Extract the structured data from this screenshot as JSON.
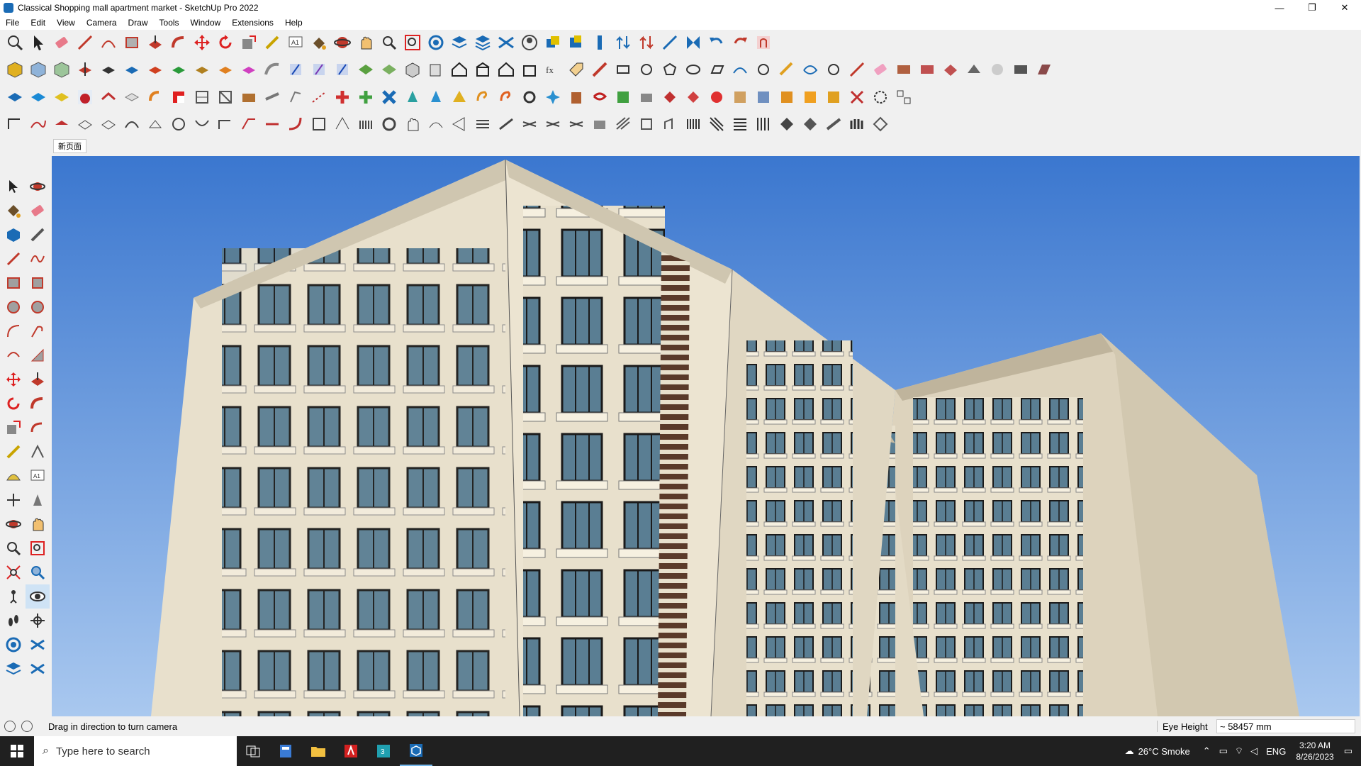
{
  "window": {
    "title": "Classical Shopping mall apartment market - SketchUp Pro 2022",
    "controls": {
      "minimize": "—",
      "restore": "❐",
      "close": "✕"
    }
  },
  "menu": [
    "File",
    "Edit",
    "View",
    "Camera",
    "Draw",
    "Tools",
    "Window",
    "Extensions",
    "Help"
  ],
  "scene_tab": "新页面",
  "status": {
    "hint": "Drag in direction to turn camera",
    "measure_label": "Eye Height",
    "measure_value": "~ 58457 mm"
  },
  "taskbar": {
    "search_placeholder": "Type here to search",
    "weather": "26°C  Smoke",
    "language": "ENG",
    "time": "3:20 AM",
    "date": "8/26/2023"
  },
  "colors": {
    "sky_top": "#3b77cf",
    "sky_bottom": "#a9c8ef",
    "facade": "#e8e0cc",
    "facade_shade": "#cfc6b0",
    "window_glass": "#5a7e93",
    "accent_brick": "#5a3a2a"
  },
  "icons": {
    "toolbar_row1": [
      "zoom-icon",
      "select-icon",
      "eraser-icon",
      "pencil-icon",
      "lasso-icon",
      "rectangle-icon",
      "pushpull-icon",
      "followme-icon",
      "move-icon",
      "rotate-icon",
      "scale-icon",
      "tape-icon",
      "text-icon",
      "paint-icon",
      "orbit-icon",
      "pan-icon",
      "zoom-window-icon",
      "zoom-extents-icon",
      "section-icon",
      "layers-icon",
      "outliner-icon",
      "components-icon",
      "account-icon",
      "warehouse-icon",
      "extension-icon",
      "solid-icon",
      "flip-icon",
      "axes-icon",
      "align-icon",
      "undo-icon",
      "redo-icon",
      "help-icon"
    ]
  }
}
